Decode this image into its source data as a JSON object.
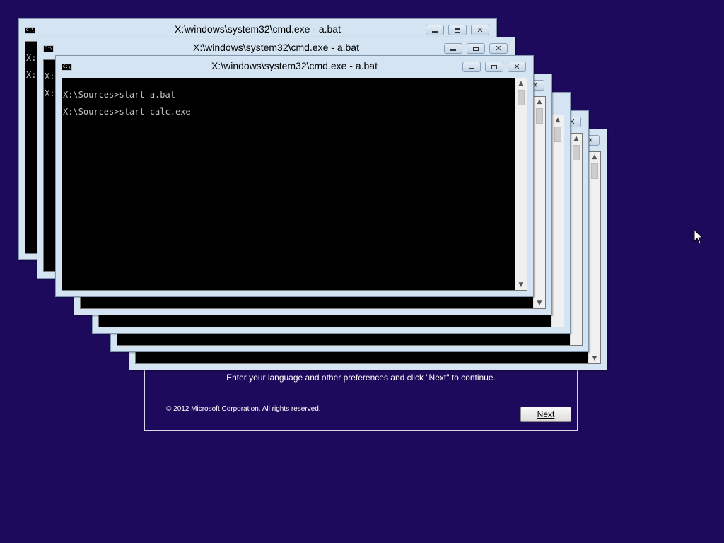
{
  "setup": {
    "instruction": "Enter your language and other preferences and click \"Next\" to continue.",
    "copyright": "© 2012 Microsoft Corporation. All rights reserved.",
    "next_label": "Next"
  },
  "console": {
    "title": "X:\\windows\\system32\\cmd.exe - a.bat",
    "icon_text": "C:\\.",
    "line1": "X:\\Sources>start a.bat",
    "line2": "X:\\Sources>start calc.exe",
    "partial_prompt": "X:"
  },
  "icons": {
    "minimize": "minimize-icon",
    "maximize": "maximize-icon",
    "close": "close-icon",
    "pointer": "mouse-pointer-icon"
  },
  "colors": {
    "desktop": "#1e0a5c",
    "console_bg": "#000000",
    "console_text": "#c0c0c0",
    "window_frame": "#d5e4f2"
  }
}
